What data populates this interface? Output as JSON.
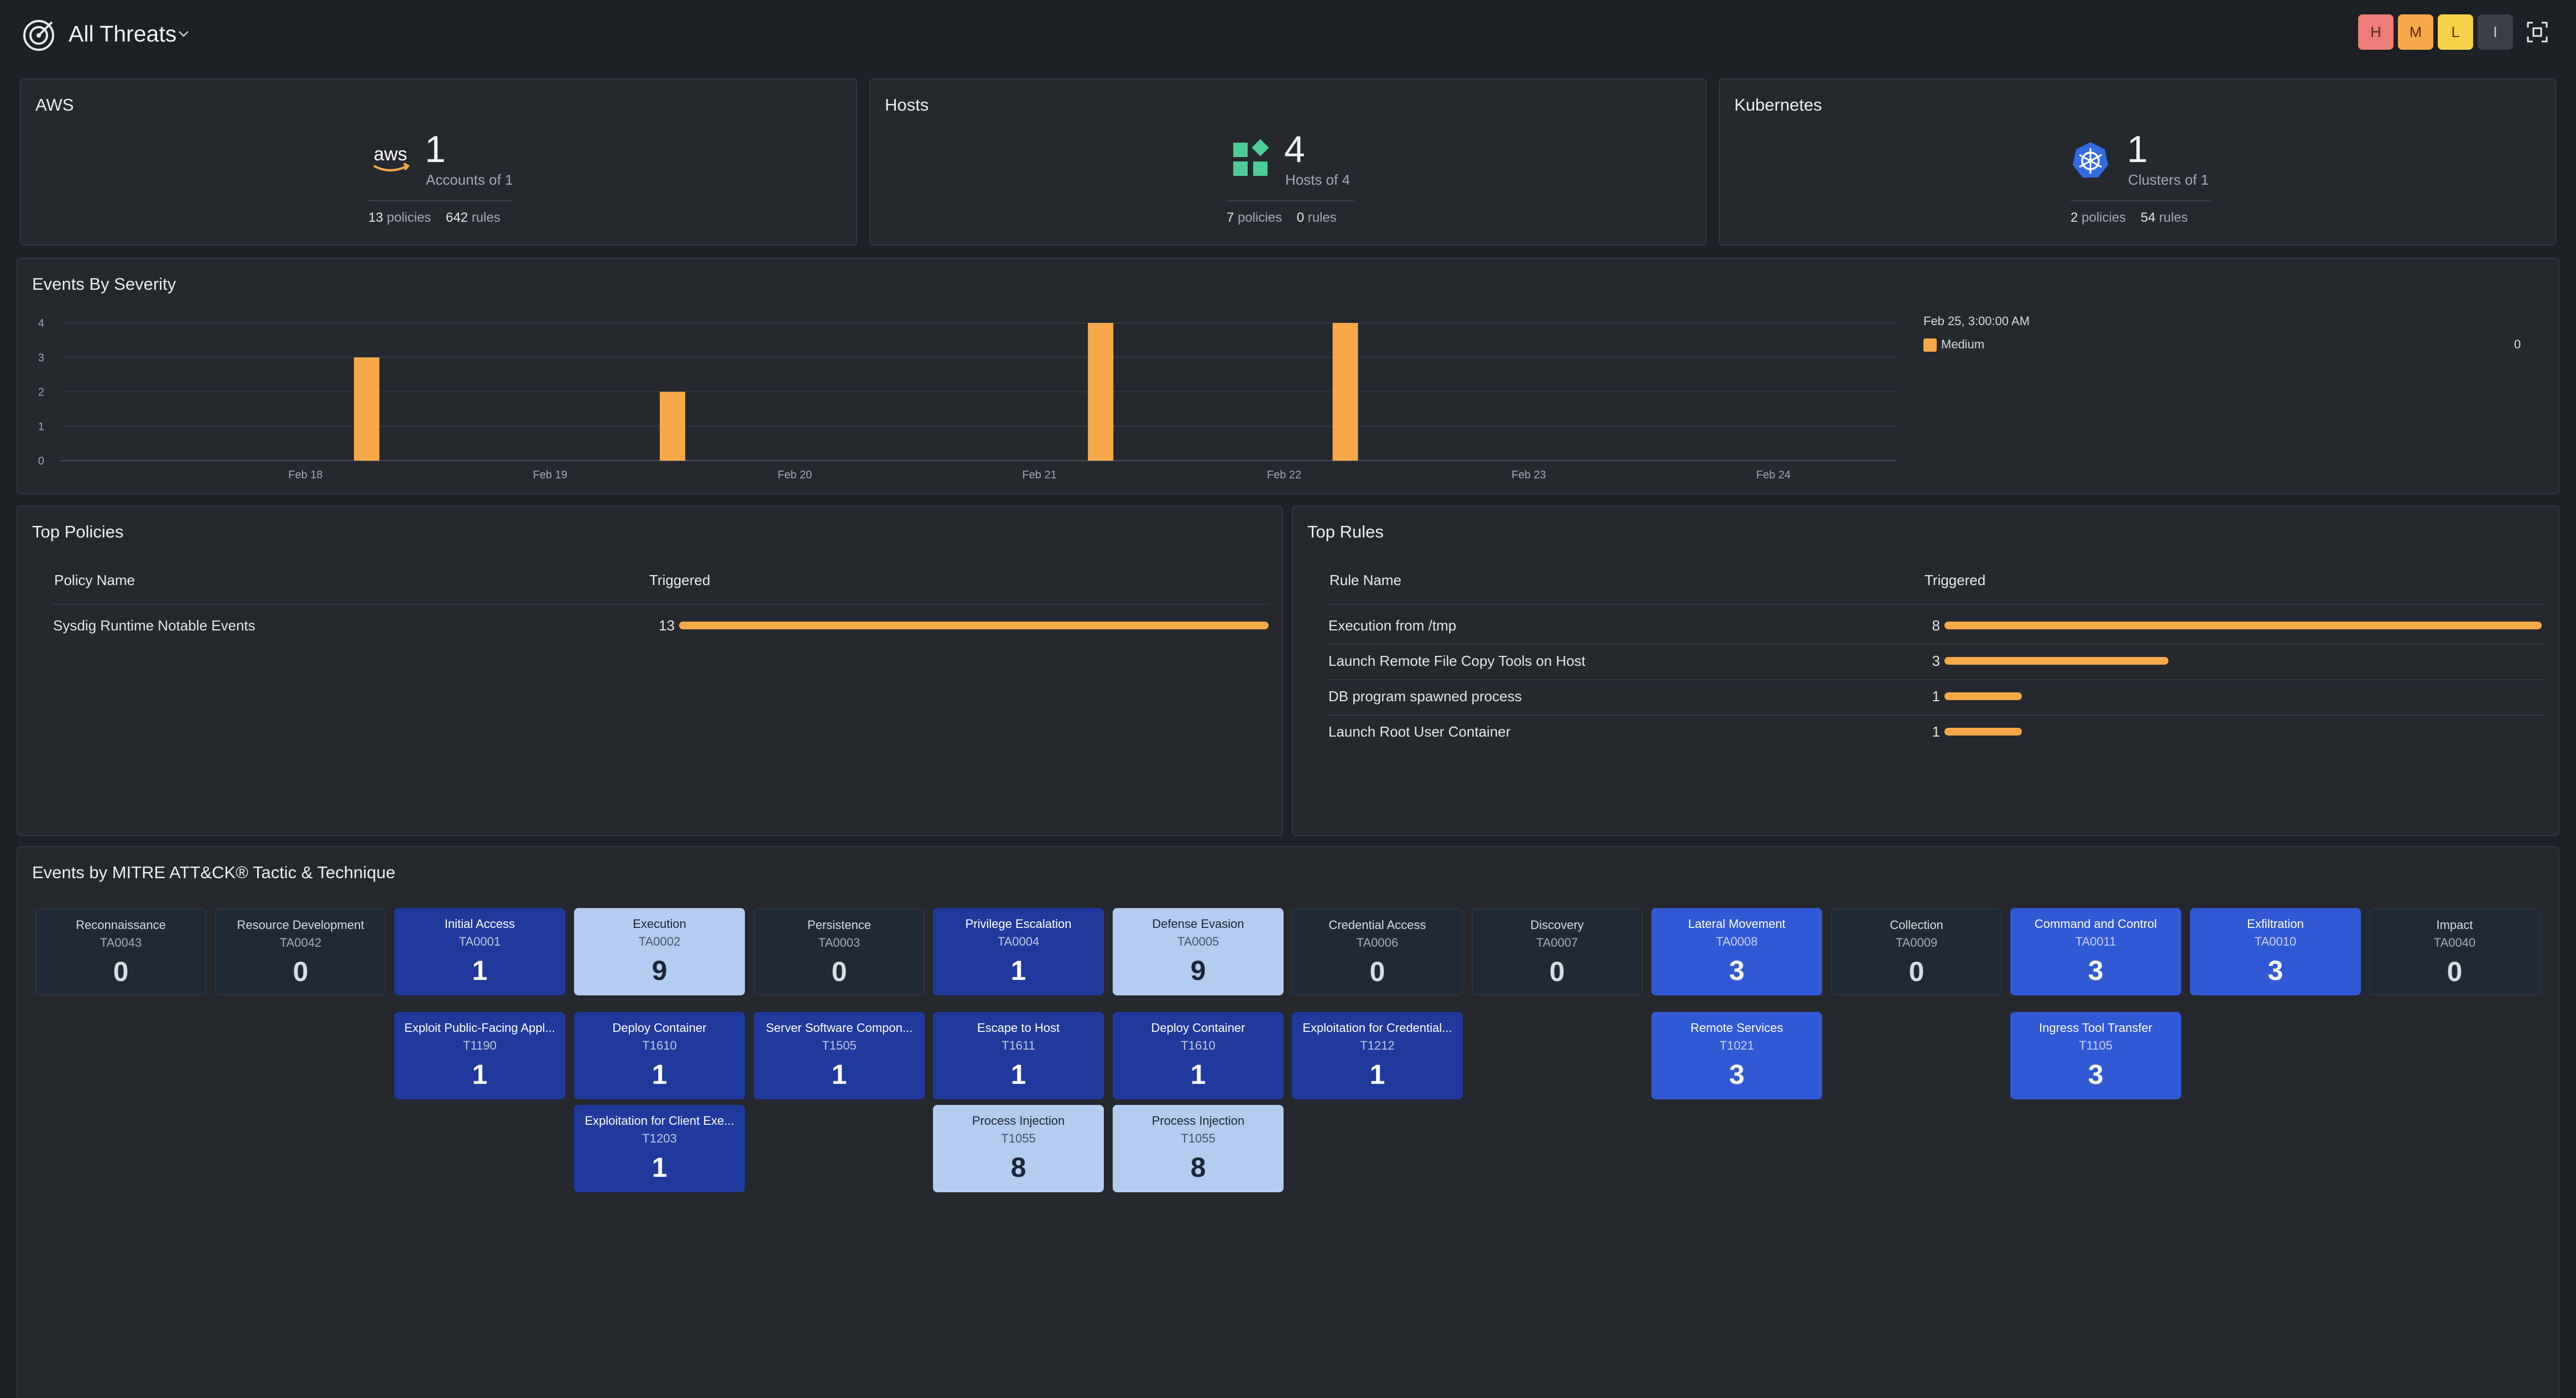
{
  "header": {
    "title": "All Threats",
    "severity_badges": [
      {
        "label": "H",
        "color": "#ee7c78"
      },
      {
        "label": "M",
        "color": "#f7a94a"
      },
      {
        "label": "L",
        "color": "#f4d24a"
      },
      {
        "label": "I",
        "color": "#3a3f46"
      }
    ],
    "icons": {
      "logo": "radar-icon",
      "menu": "chevron-down-icon",
      "action": "scan-icon"
    }
  },
  "stat_cards": [
    {
      "title": "AWS",
      "icon": "aws-logo-icon",
      "count": "1",
      "caption": "Accounts of 1",
      "policies": "13",
      "policies_label": "policies",
      "rules": "642",
      "rules_label": "rules"
    },
    {
      "title": "Hosts",
      "icon": "hosts-icon",
      "count": "4",
      "caption": "Hosts of 4",
      "policies": "7",
      "policies_label": "policies",
      "rules": "0",
      "rules_label": "rules"
    },
    {
      "title": "Kubernetes",
      "icon": "kubernetes-icon",
      "count": "1",
      "caption": "Clusters of 1",
      "policies": "2",
      "policies_label": "policies",
      "rules": "54",
      "rules_label": "rules"
    }
  ],
  "severity_chart": {
    "title": "Events By Severity",
    "legend": {
      "date": "Feb 25, 3:00:00 AM",
      "series": "Medium",
      "value": "0"
    }
  },
  "chart_data": {
    "type": "bar",
    "title": "Events By Severity",
    "x_ticks": [
      "Feb 18",
      "Feb 19",
      "Feb 20",
      "Feb 21",
      "Feb 22",
      "Feb 23",
      "Feb 24"
    ],
    "y_ticks": [
      "0",
      "1",
      "2",
      "3",
      "4"
    ],
    "ylim": [
      0,
      4
    ],
    "xlim_days": [
      17.0,
      24.5
    ],
    "series": [
      {
        "name": "Medium",
        "color": "#f7a94a",
        "points": [
          {
            "x": "Feb 18",
            "day": 18.25,
            "y": 3
          },
          {
            "x": "Feb 19",
            "day": 19.5,
            "y": 2
          },
          {
            "x": "Feb 21",
            "day": 21.25,
            "y": 4
          },
          {
            "x": "Feb 22",
            "day": 22.25,
            "y": 4
          }
        ]
      }
    ],
    "grid": true,
    "legend_position": "right"
  },
  "top_policies": {
    "title": "Top Policies",
    "columns": [
      "Policy Name",
      "Triggered"
    ],
    "max": 13,
    "rows": [
      {
        "name": "Sysdig Runtime Notable Events",
        "count": 13
      }
    ]
  },
  "top_rules": {
    "title": "Top Rules",
    "columns": [
      "Rule Name",
      "Triggered"
    ],
    "max": 8,
    "rows": [
      {
        "name": "Execution from /tmp",
        "count": 8
      },
      {
        "name": "Launch Remote File Copy Tools on Host",
        "count": 3
      },
      {
        "name": "DB program spawned process",
        "count": 1
      },
      {
        "name": "Launch Root User Container",
        "count": 1
      }
    ]
  },
  "mitre": {
    "title": "Events by MITRE ATT&CK® Tactic & Technique",
    "tactics": [
      {
        "name": "Reconnaissance",
        "id": "TA0043",
        "count": 0,
        "techniques": []
      },
      {
        "name": "Resource Development",
        "id": "TA0042",
        "count": 0,
        "techniques": []
      },
      {
        "name": "Initial Access",
        "id": "TA0001",
        "count": 1,
        "techniques": [
          {
            "name": "Exploit Public-Facing Appl...",
            "id": "T1190",
            "count": 1
          }
        ]
      },
      {
        "name": "Execution",
        "id": "TA0002",
        "count": 9,
        "techniques": [
          {
            "name": "Deploy Container",
            "id": "T1610",
            "count": 1
          },
          {
            "name": "Exploitation for Client Exe...",
            "id": "T1203",
            "count": 1
          }
        ]
      },
      {
        "name": "Persistence",
        "id": "TA0003",
        "count": 0,
        "techniques": [
          {
            "name": "Server Software Compon...",
            "id": "T1505",
            "count": 1
          }
        ]
      },
      {
        "name": "Privilege Escalation",
        "id": "TA0004",
        "count": 1,
        "techniques": [
          {
            "name": "Escape to Host",
            "id": "T1611",
            "count": 1
          },
          {
            "name": "Process Injection",
            "id": "T1055",
            "count": 8
          }
        ]
      },
      {
        "name": "Defense Evasion",
        "id": "TA0005",
        "count": 9,
        "techniques": [
          {
            "name": "Deploy Container",
            "id": "T1610",
            "count": 1
          },
          {
            "name": "Process Injection",
            "id": "T1055",
            "count": 8
          }
        ]
      },
      {
        "name": "Credential Access",
        "id": "TA0006",
        "count": 0,
        "techniques": [
          {
            "name": "Exploitation for Credential...",
            "id": "T1212",
            "count": 1
          }
        ]
      },
      {
        "name": "Discovery",
        "id": "TA0007",
        "count": 0,
        "techniques": []
      },
      {
        "name": "Lateral Movement",
        "id": "TA0008",
        "count": 3,
        "techniques": [
          {
            "name": "Remote Services",
            "id": "T1021",
            "count": 3
          }
        ]
      },
      {
        "name": "Collection",
        "id": "TA0009",
        "count": 0,
        "techniques": []
      },
      {
        "name": "Command and Control",
        "id": "TA0011",
        "count": 3,
        "techniques": [
          {
            "name": "Ingress Tool Transfer",
            "id": "T1105",
            "count": 3
          }
        ]
      },
      {
        "name": "Exfiltration",
        "id": "TA0010",
        "count": 3,
        "techniques": []
      },
      {
        "name": "Impact",
        "id": "TA0040",
        "count": 0,
        "techniques": []
      }
    ]
  }
}
